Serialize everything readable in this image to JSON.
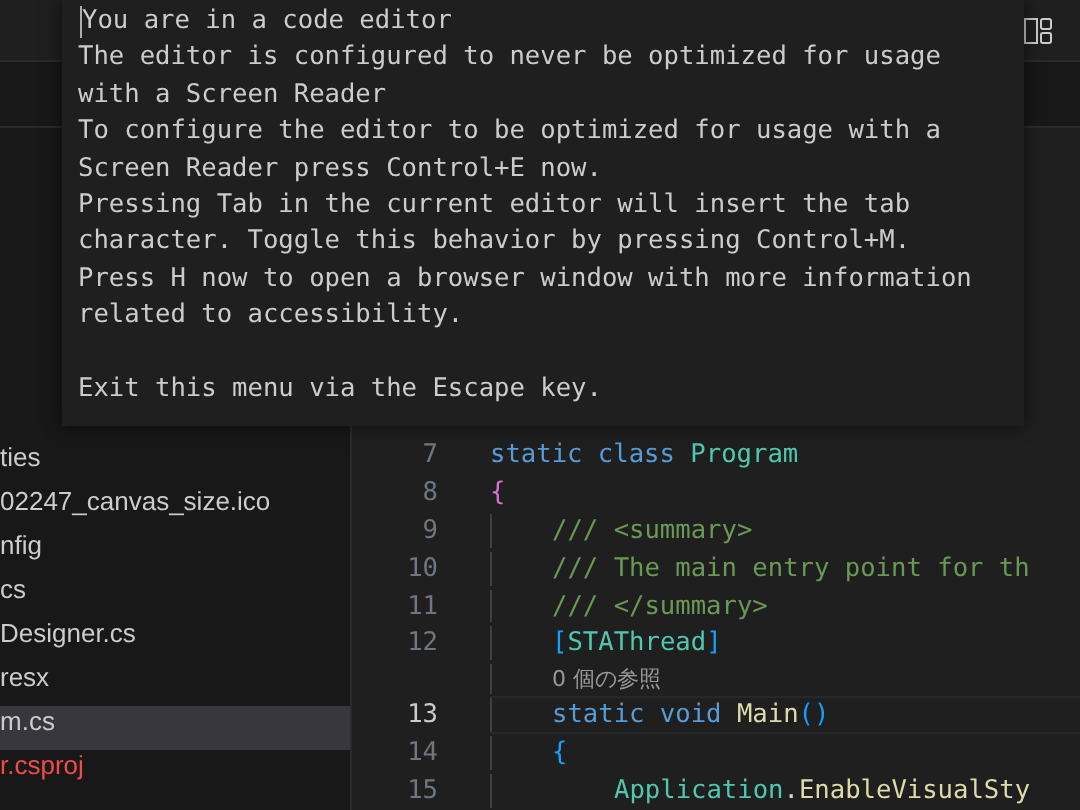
{
  "help_overlay": {
    "lines": [
      "You are in a code editor",
      "The editor is configured to never be optimized for usage",
      "with a Screen Reader",
      "To configure the editor to be optimized for usage with a",
      "Screen Reader press Control+E now.",
      "Pressing Tab in the current editor will insert the tab",
      "character. Toggle this behavior by pressing Control+M.",
      "Press H now to open a browser window with more information",
      "related to accessibility."
    ],
    "footer": "Exit this menu via the Escape key."
  },
  "sidebar": {
    "items": [
      {
        "label": "ties",
        "selected": false,
        "modified": false
      },
      {
        "label": "02247_canvas_size.ico",
        "selected": false,
        "modified": false
      },
      {
        "label": "nfig",
        "selected": false,
        "modified": false
      },
      {
        "label": "cs",
        "selected": false,
        "modified": false
      },
      {
        "label": "Designer.cs",
        "selected": false,
        "modified": false
      },
      {
        "label": "resx",
        "selected": false,
        "modified": false
      },
      {
        "label": "m.cs",
        "selected": true,
        "modified": false
      },
      {
        "label": "r.csproj",
        "selected": false,
        "modified": true
      }
    ]
  },
  "editor": {
    "rows": [
      {
        "kind": "line",
        "number": "7",
        "current": false,
        "tokens": [
          {
            "text": "static class ",
            "kind": "keyword"
          },
          {
            "text": "Program",
            "kind": "type"
          }
        ]
      },
      {
        "kind": "line",
        "number": "8",
        "current": false,
        "tokens": [
          {
            "text": "{",
            "kind": "brace1"
          }
        ],
        "children": [
          {
            "kind": "line",
            "number": "9",
            "current": false,
            "tokens": [
              {
                "text": "/// <summary>",
                "kind": "comment"
              }
            ]
          },
          {
            "kind": "line",
            "number": "10",
            "current": false,
            "tokens": [
              {
                "text": "/// The main entry point for th",
                "kind": "comment"
              }
            ]
          },
          {
            "kind": "line",
            "number": "11",
            "current": false,
            "tokens": [
              {
                "text": "/// </summary>",
                "kind": "comment"
              }
            ]
          },
          {
            "kind": "line",
            "number": "12",
            "current": false,
            "tokens": [
              {
                "text": "[",
                "kind": "brace2"
              },
              {
                "text": "STAThread",
                "kind": "type"
              },
              {
                "text": "]",
                "kind": "brace2"
              }
            ]
          },
          {
            "kind": "codelens",
            "text": "0 個の参照"
          },
          {
            "kind": "line",
            "number": "13",
            "current": true,
            "tokens": [
              {
                "text": "static void ",
                "kind": "keyword"
              },
              {
                "text": "Main",
                "kind": "method"
              },
              {
                "text": "()",
                "kind": "brace2"
              }
            ]
          },
          {
            "kind": "line",
            "number": "14",
            "current": false,
            "tokens": [
              {
                "text": "{",
                "kind": "brace2"
              }
            ],
            "children": [
              {
                "kind": "line",
                "number": "15",
                "current": false,
                "tokens": [
                  {
                    "text": "Application",
                    "kind": "type"
                  },
                  {
                    "text": ".",
                    "kind": "plain"
                  },
                  {
                    "text": "EnableVisualSty",
                    "kind": "method"
                  }
                ]
              }
            ]
          }
        ]
      }
    ]
  }
}
